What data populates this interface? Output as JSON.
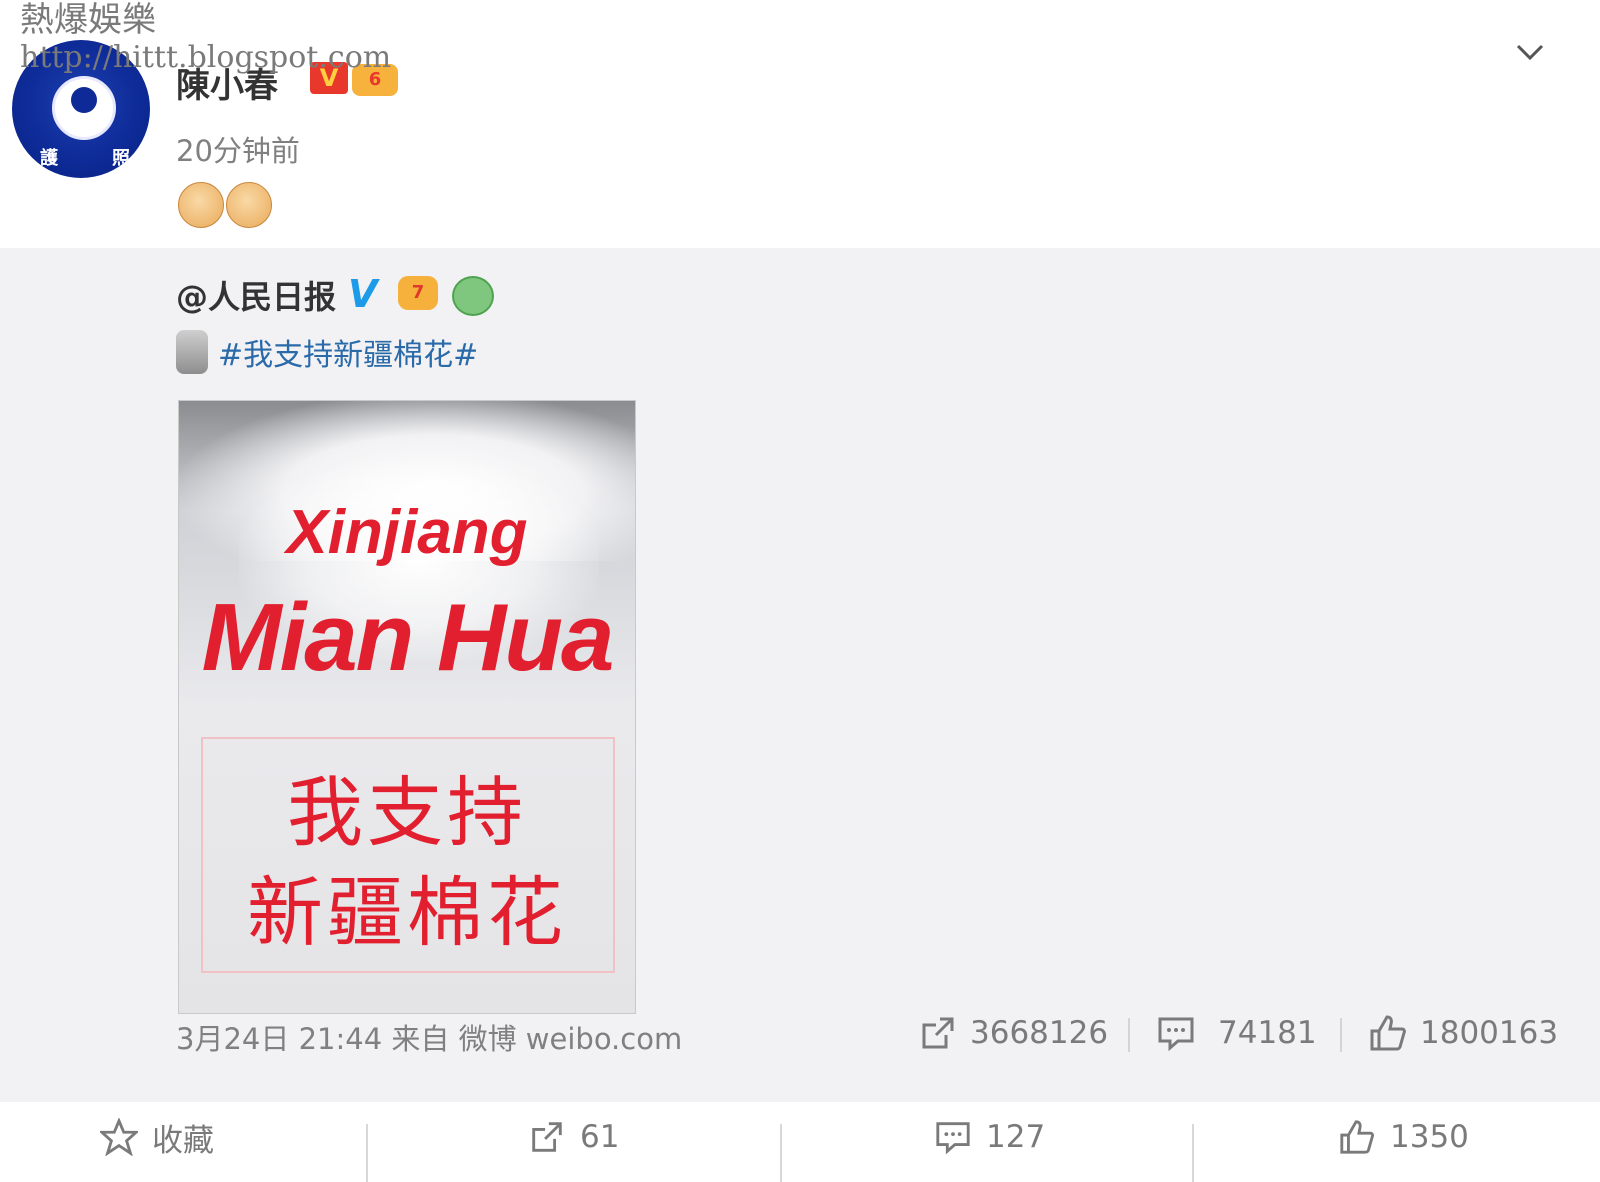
{
  "watermark": {
    "line1": "熱爆娛樂",
    "line2": "http://hittt.blogspot.com"
  },
  "post": {
    "author": "陳小春",
    "badge_v": "V",
    "badge_level": "6",
    "time": "20分钟前",
    "content_emoji": [
      "fist-emoji",
      "fist-emoji"
    ]
  },
  "repost": {
    "author": "@人民日报",
    "verify": "V",
    "badge_level": "7",
    "hashtag": "#我支持新疆棉花#",
    "image": {
      "line1": "Xinjiang",
      "line2": "Mian Hua",
      "zh_line1": "我支持",
      "zh_line2": "新疆棉花"
    },
    "meta": "3月24日 21:44 来自 微博 weibo.com",
    "stats": {
      "reposts": "3668126",
      "comments": "74181",
      "likes": "1800163"
    }
  },
  "actions": {
    "favorite_label": "收藏",
    "repost_count": "61",
    "comment_count": "127",
    "like_count": "1350"
  },
  "colors": {
    "accent_red": "#e11f2f",
    "hashtag_blue": "#2a6aa8",
    "verify_blue": "#1d9be8",
    "repost_bg": "#f2f2f5"
  }
}
